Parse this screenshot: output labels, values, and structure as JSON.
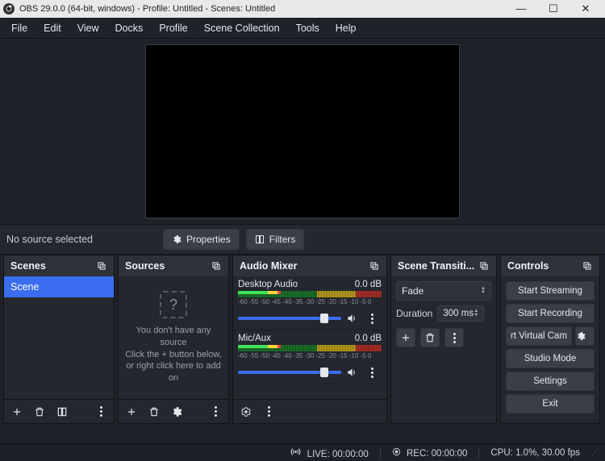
{
  "titlebar": {
    "text": "OBS 29.0.0 (64-bit, windows) - Profile: Untitled - Scenes: Untitled"
  },
  "menu": {
    "file": "File",
    "edit": "Edit",
    "view": "View",
    "docks": "Docks",
    "profile": "Profile",
    "scene_collection": "Scene Collection",
    "tools": "Tools",
    "help": "Help"
  },
  "props": {
    "no_source": "No source selected",
    "properties": "Properties",
    "filters": "Filters"
  },
  "scenes": {
    "title": "Scenes",
    "items": [
      {
        "label": "Scene"
      }
    ]
  },
  "sources": {
    "title": "Sources",
    "empty_line1": "You don't have any source",
    "empty_line2": "Click the + button below,",
    "empty_line3": "or right click here to add on"
  },
  "mixer": {
    "title": "Audio Mixer",
    "scale": "-60 -55 -50 -45 -40 -35 -30 -25 -20 -15 -10 -5 0",
    "channels": [
      {
        "name": "Desktop Audio",
        "level": "0.0 dB"
      },
      {
        "name": "Mic/Aux",
        "level": "0.0 dB"
      }
    ]
  },
  "transitions": {
    "title": "Scene Transiti...",
    "select": "Fade",
    "duration_label": "Duration",
    "duration_value": "300 ms"
  },
  "controls": {
    "title": "Controls",
    "start_streaming": "Start Streaming",
    "start_recording": "Start Recording",
    "virtual_cam": "rt Virtual Cam",
    "studio_mode": "Studio Mode",
    "settings": "Settings",
    "exit": "Exit"
  },
  "statusbar": {
    "live": "LIVE: 00:00:00",
    "rec": "REC: 00:00:00",
    "cpu": "CPU: 1.0%, 30.00 fps"
  }
}
